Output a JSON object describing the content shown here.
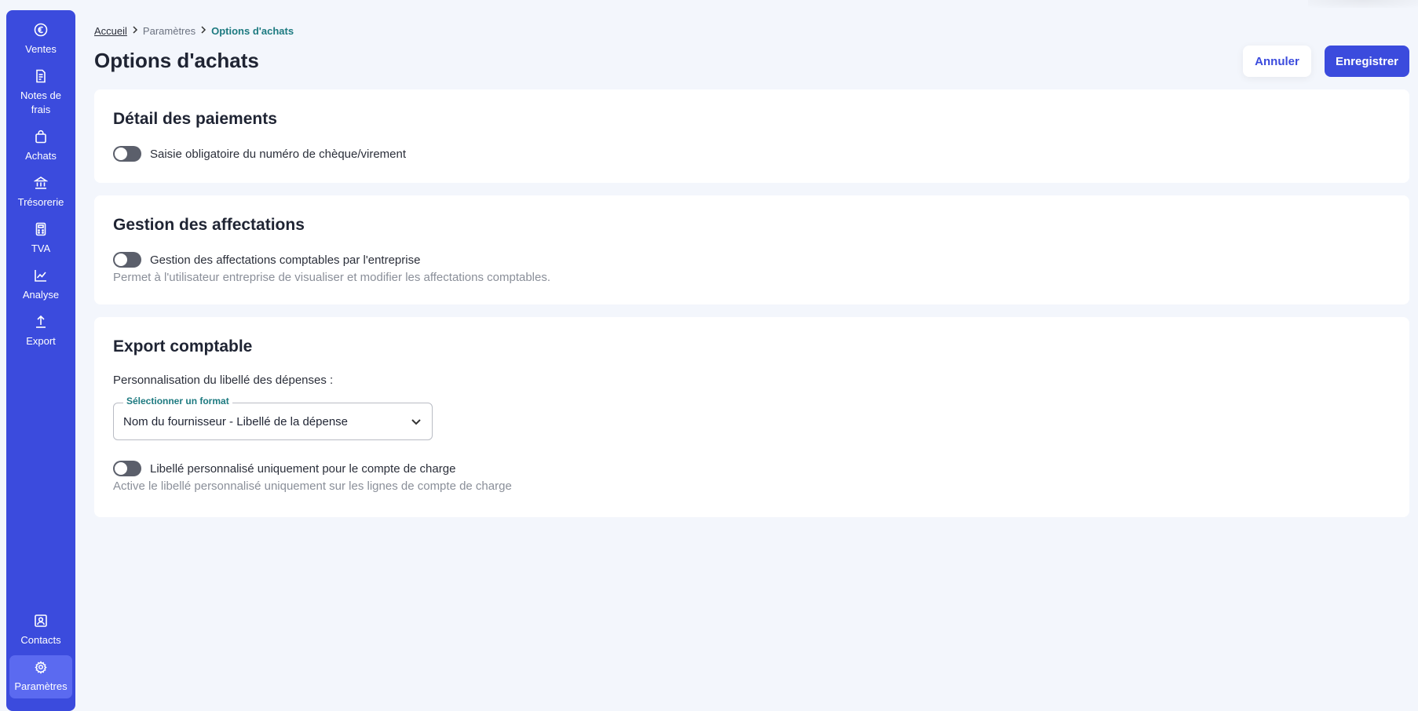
{
  "sidebar": {
    "items": [
      {
        "label": "Ventes",
        "icon": "euro-icon"
      },
      {
        "label": "Notes de frais",
        "icon": "receipt-icon"
      },
      {
        "label": "Achats",
        "icon": "shopping-bag-icon"
      },
      {
        "label": "Trésorerie",
        "icon": "bank-icon"
      },
      {
        "label": "TVA",
        "icon": "calculator-icon"
      },
      {
        "label": "Analyse",
        "icon": "chart-line-icon"
      },
      {
        "label": "Export",
        "icon": "upload-icon"
      }
    ],
    "bottom_items": [
      {
        "label": "Contacts",
        "icon": "contact-icon"
      },
      {
        "label": "Paramètres",
        "icon": "gear-icon",
        "active": true
      }
    ]
  },
  "breadcrumb": {
    "home": "Accueil",
    "parent": "Paramètres",
    "current": "Options d'achats"
  },
  "header": {
    "title": "Options d'achats",
    "cancel_label": "Annuler",
    "save_label": "Enregistrer"
  },
  "payments": {
    "title": "Détail des paiements",
    "toggle_label": "Saisie obligatoire du numéro de chèque/virement",
    "toggle_on": false
  },
  "assignments": {
    "title": "Gestion des affectations",
    "toggle_label": "Gestion des affectations comptables par l'entreprise",
    "toggle_on": false,
    "helper": "Permet à l'utilisateur entreprise de visualiser et modifier les affectations comptables."
  },
  "export": {
    "title": "Export comptable",
    "label": "Personnalisation du libellé des dépenses :",
    "select_legend": "Sélectionner un format",
    "select_value": "Nom du fournisseur - Libellé de la dépense",
    "toggle_label": "Libellé personnalisé uniquement pour le compte de charge",
    "toggle_on": false,
    "helper": "Active le libellé personnalisé uniquement sur les lignes de compte de charge"
  },
  "colors": {
    "sidebar": "#3b4bdd",
    "accent": "#3b4bdd",
    "teal": "#1d7a80",
    "background": "#f3f6fc"
  }
}
